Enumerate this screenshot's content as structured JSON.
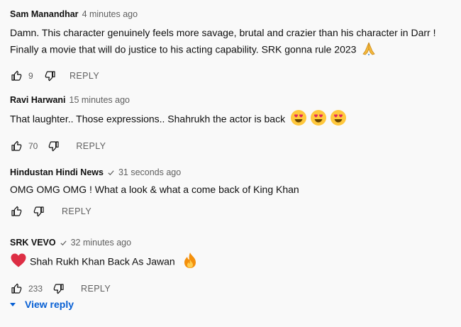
{
  "comments": [
    {
      "author": "Sam Manandhar",
      "verified": false,
      "time": "4 minutes ago",
      "lines": [
        "Damn. This character genuinely feels more savage, brutal and crazier than his character in Darr !",
        "Finally a movie that will do justice to his acting capability. SRK gonna rule 2023"
      ],
      "emojis": [
        "folded-hands"
      ],
      "likes": "9",
      "reply_label": "REPLY"
    },
    {
      "author": "Ravi Harwani",
      "verified": false,
      "time": "15 minutes ago",
      "text": "That laughter.. Those expressions.. Shahrukh the actor is back",
      "emojis": [
        "heart-eyes",
        "heart-eyes",
        "heart-eyes"
      ],
      "likes": "70",
      "reply_label": "REPLY"
    },
    {
      "author": "Hindustan Hindi News",
      "verified": true,
      "time": "31 seconds ago",
      "text": "OMG OMG OMG ! What a look & what a come back of King Khan",
      "likes": "",
      "reply_label": "REPLY"
    },
    {
      "author": "SRK VEVO",
      "verified": true,
      "time": "32 minutes ago",
      "text": "Shah Rukh Khan Back As Jawan",
      "emojis_before": [
        "red-heart"
      ],
      "emojis": [
        "fire"
      ],
      "likes": "233",
      "reply_label": "REPLY"
    }
  ],
  "view_reply_label": "View reply",
  "colors": {
    "link": "#065fd4",
    "secondary_text": "#606060",
    "primary_text": "#0f0f0f",
    "background": "#f9f9f9"
  }
}
